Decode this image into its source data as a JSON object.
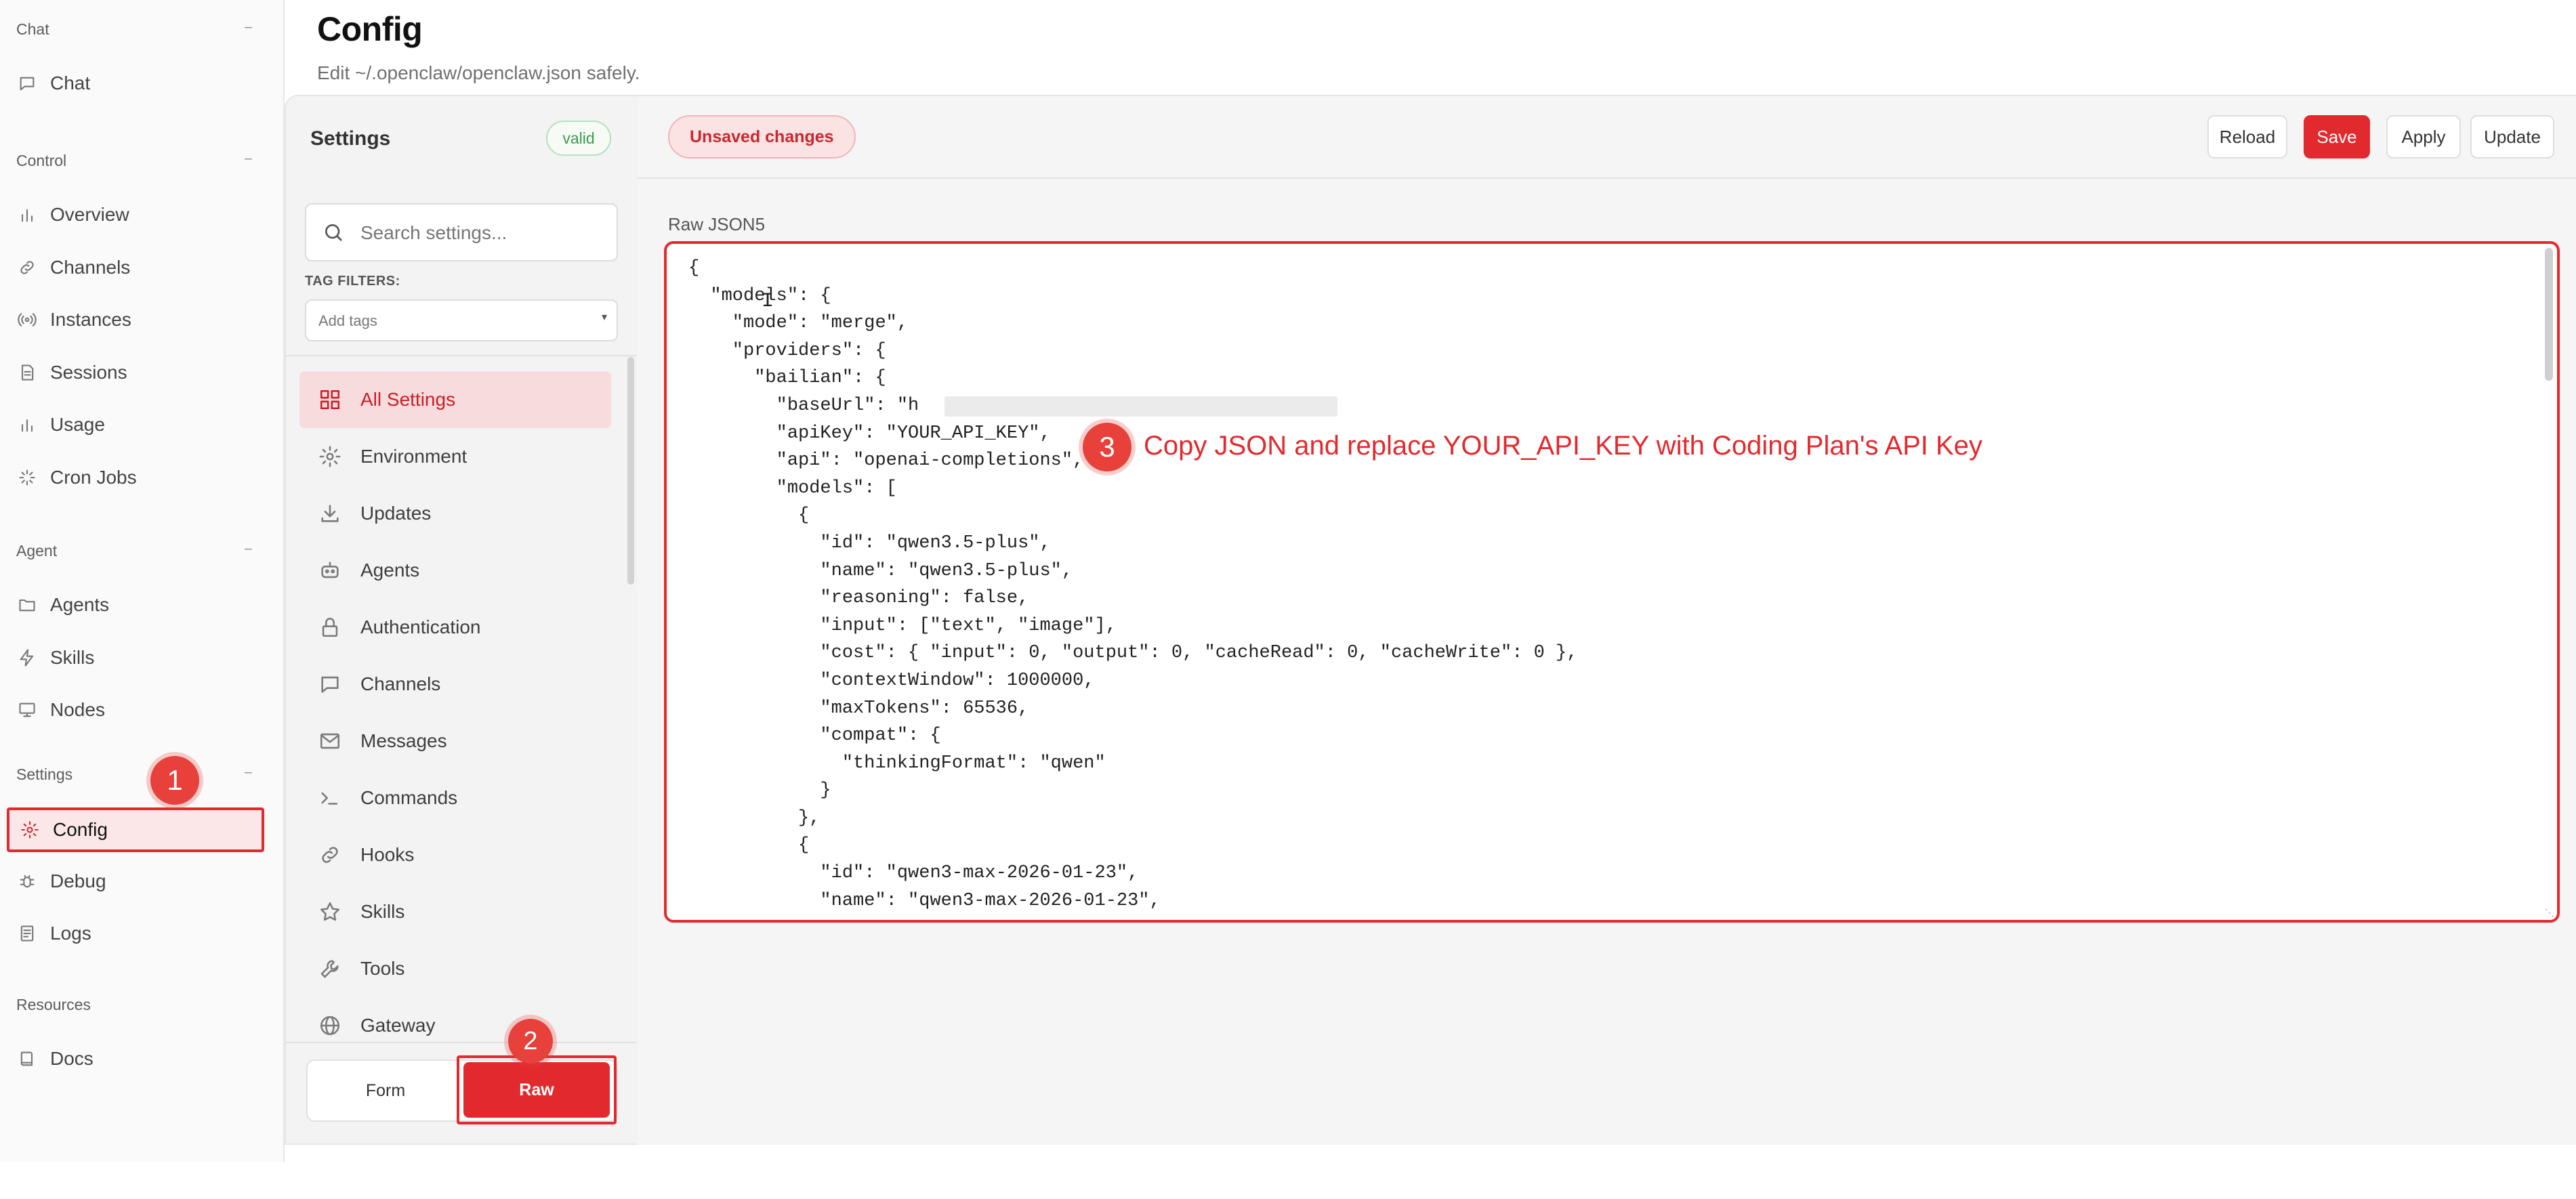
{
  "nav": {
    "groups": [
      {
        "label": "Chat",
        "collapse": "−",
        "items": [
          {
            "label": "Chat",
            "icon": "chat-bubble-icon"
          }
        ]
      },
      {
        "label": "Control",
        "collapse": "−",
        "items": [
          {
            "label": "Overview",
            "icon": "bar-chart-icon"
          },
          {
            "label": "Channels",
            "icon": "link-icon"
          },
          {
            "label": "Instances",
            "icon": "radio-waves-icon"
          },
          {
            "label": "Sessions",
            "icon": "document-icon"
          },
          {
            "label": "Usage",
            "icon": "bar-chart-icon"
          },
          {
            "label": "Cron Jobs",
            "icon": "loader-icon"
          }
        ]
      },
      {
        "label": "Agent",
        "collapse": "−",
        "items": [
          {
            "label": "Agents",
            "icon": "folder-icon"
          },
          {
            "label": "Skills",
            "icon": "lightning-icon"
          },
          {
            "label": "Nodes",
            "icon": "monitor-icon"
          }
        ]
      },
      {
        "label": "Settings",
        "collapse": "−",
        "items": [
          {
            "label": "Config",
            "icon": "gear-icon"
          },
          {
            "label": "Debug",
            "icon": "bug-icon"
          },
          {
            "label": "Logs",
            "icon": "logs-icon"
          }
        ]
      },
      {
        "label": "Resources",
        "items": [
          {
            "label": "Docs",
            "icon": "book-icon"
          }
        ]
      }
    ]
  },
  "header": {
    "title": "Config",
    "subtitle": "Edit ~/.openclaw/openclaw.json safely."
  },
  "settings": {
    "title": "Settings",
    "valid_badge": "valid",
    "search_placeholder": "Search settings...",
    "tag_filters_label": "TAG FILTERS:",
    "tags_placeholder": "Add tags",
    "items": [
      {
        "label": "All Settings",
        "icon": "grid-icon"
      },
      {
        "label": "Environment",
        "icon": "gear-icon"
      },
      {
        "label": "Updates",
        "icon": "download-icon"
      },
      {
        "label": "Agents",
        "icon": "robot-icon"
      },
      {
        "label": "Authentication",
        "icon": "lock-icon"
      },
      {
        "label": "Channels",
        "icon": "chat-bubble-icon"
      },
      {
        "label": "Messages",
        "icon": "envelope-icon"
      },
      {
        "label": "Commands",
        "icon": "terminal-icon"
      },
      {
        "label": "Hooks",
        "icon": "link-icon"
      },
      {
        "label": "Skills",
        "icon": "star-icon"
      },
      {
        "label": "Tools",
        "icon": "wrench-icon"
      },
      {
        "label": "Gateway",
        "icon": "globe-icon"
      }
    ],
    "form_label": "Form",
    "raw_label": "Raw"
  },
  "toolbar": {
    "unsaved": "Unsaved changes",
    "reload": "Reload",
    "save": "Save",
    "apply": "Apply",
    "update": "Update"
  },
  "editor": {
    "label": "Raw JSON5",
    "lines": [
      "{",
      "  \"models\": {",
      "    \"mode\": \"merge\",",
      "    \"providers\": {",
      "      \"bailian\": {",
      "        \"baseUrl\": \"h                                  \",",
      "        \"apiKey\": \"YOUR_API_KEY\",",
      "        \"api\": \"openai-completions\",",
      "        \"models\": [",
      "          {",
      "            \"id\": \"qwen3.5-plus\",",
      "            \"name\": \"qwen3.5-plus\",",
      "            \"reasoning\": false,",
      "            \"input\": [\"text\", \"image\"],",
      "            \"cost\": { \"input\": 0, \"output\": 0, \"cacheRead\": 0, \"cacheWrite\": 0 },",
      "            \"contextWindow\": 1000000,",
      "            \"maxTokens\": 65536,",
      "            \"compat\": {",
      "              \"thinkingFormat\": \"qwen\"",
      "            }",
      "          },",
      "          {",
      "            \"id\": \"qwen3-max-2026-01-23\",",
      "            \"name\": \"qwen3-max-2026-01-23\","
    ]
  },
  "annotations": {
    "step1": "1",
    "step2": "2",
    "step3": "3",
    "step3_text": "Copy JSON and replace YOUR_API_KEY with Coding Plan's API Key",
    "color": "#e22a2e"
  }
}
